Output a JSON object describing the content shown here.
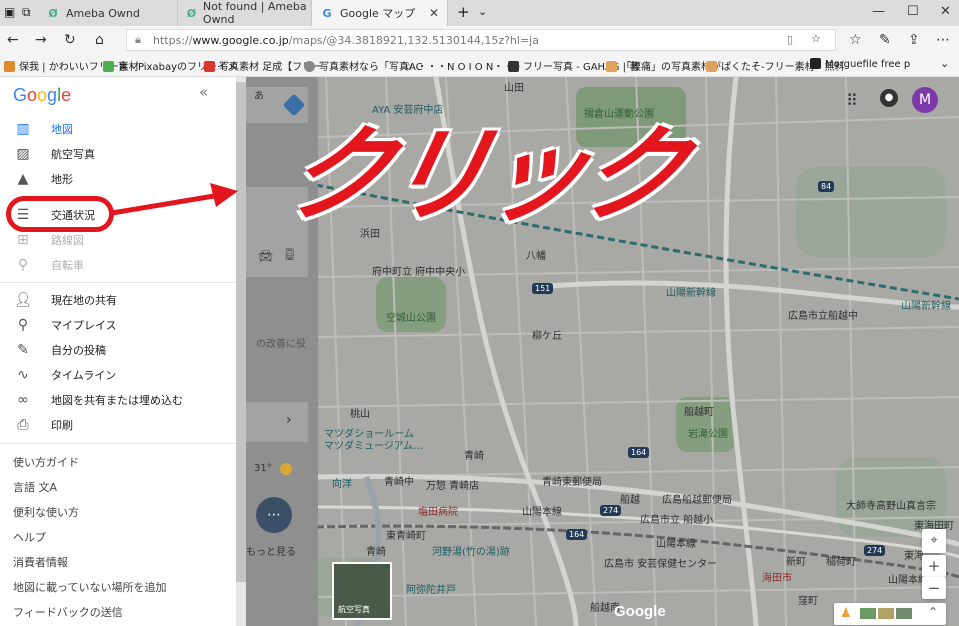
{
  "browser": {
    "tabs": [
      {
        "title": "Ameba Ownd"
      },
      {
        "title": "Not found | Ameba Ownd"
      },
      {
        "title": "Google マップ"
      }
    ],
    "new_tab": "+",
    "url_prefix": "https://",
    "url_host": "www.google.co.jp",
    "url_path": "/maps/@34.3818921,132.5130144,15z?hl=ja"
  },
  "favorites": [
    {
      "label": "保我 | かわいいフリー素材",
      "color": "#e08a2c"
    },
    {
      "label": "盲 - Pixabayのフリーイメ",
      "color": "#4caf50"
    },
    {
      "label": "写真素材 足成【フリー",
      "color": "#d8372f"
    },
    {
      "label": "写真素材なら「写真AC",
      "color": "#888888"
    },
    {
      "label": "・・・N O I O N・・・",
      "color": "#ffffff"
    },
    {
      "label": "フリー写真 - GAHAG | 著",
      "color": "#333333"
    },
    {
      "label": "「腰痛」の写真素材が",
      "color": "#e0a060"
    },
    {
      "label": "ぱくたそ-フリー素材・無料",
      "color": "#e0a060"
    },
    {
      "label": "Morguefile free photo",
      "color": "#222222"
    }
  ],
  "sidebar": {
    "logo": "Google",
    "collapse": "«",
    "layers": [
      {
        "label": "地図",
        "state": "active"
      },
      {
        "label": "航空写真",
        "state": "normal"
      },
      {
        "label": "地形",
        "state": "normal"
      },
      {
        "label": "交通状況",
        "state": "normal"
      },
      {
        "label": "路線図",
        "state": "disabled"
      },
      {
        "label": "自転車",
        "state": "disabled"
      }
    ],
    "actions": [
      {
        "label": "現在地の共有"
      },
      {
        "label": "マイプレイス"
      },
      {
        "label": "自分の投稿"
      },
      {
        "label": "タイムライン"
      },
      {
        "label": "地図を共有または埋め込む"
      },
      {
        "label": "印刷"
      }
    ],
    "links": [
      {
        "label": "使い方ガイド"
      },
      {
        "label": "言語 文A"
      },
      {
        "label": "便利な使い方"
      },
      {
        "label": "ヘルプ"
      },
      {
        "label": "消費者情報"
      },
      {
        "label": "地図に載っていない場所を追加"
      },
      {
        "label": "フィードバックの送信"
      }
    ]
  },
  "annotation": {
    "text": "クリック",
    "color": "#e3151d"
  },
  "panel": {
    "ime": "あ",
    "partial_text": "の改善に役",
    "weather": "31°",
    "more": "もっと見る",
    "aerial_thumb": "航空写真"
  },
  "map": {
    "labels": [
      {
        "text": "AYA 安芸府中店",
        "tone": "teal"
      },
      {
        "text": "揚倉山運動公園",
        "tone": "green"
      },
      {
        "text": "山田",
        "tone": "plain"
      },
      {
        "text": "浜田",
        "tone": "plain"
      },
      {
        "text": "府中町立 府中中央小",
        "tone": "plain"
      },
      {
        "text": "八幡",
        "tone": "plain"
      },
      {
        "text": "山陽新幹線",
        "tone": "teal"
      },
      {
        "text": "山陽新幹線",
        "tone": "teal"
      },
      {
        "text": "空城山公園",
        "tone": "green"
      },
      {
        "text": "柳ケ丘",
        "tone": "plain"
      },
      {
        "text": "広島市立船越中",
        "tone": "plain"
      },
      {
        "text": "桃山",
        "tone": "plain"
      },
      {
        "text": "マツダショールーム",
        "tone": "teal"
      },
      {
        "text": "マツダミュージアム…",
        "tone": "teal"
      },
      {
        "text": "船越町",
        "tone": "plain"
      },
      {
        "text": "岩滝公園",
        "tone": "green"
      },
      {
        "text": "青崎",
        "tone": "plain"
      },
      {
        "text": "青崎中",
        "tone": "plain"
      },
      {
        "text": "向洋",
        "tone": "teal"
      },
      {
        "text": "万惣 青崎店",
        "tone": "plain"
      },
      {
        "text": "青崎東郵便局",
        "tone": "plain"
      },
      {
        "text": "船越",
        "tone": "plain"
      },
      {
        "text": "広島船越郵便局",
        "tone": "plain"
      },
      {
        "text": "大師寺高野山真言宗",
        "tone": "plain"
      },
      {
        "text": "塩田病院",
        "tone": "red"
      },
      {
        "text": "山陽本線",
        "tone": "plain"
      },
      {
        "text": "広島市立 船越小",
        "tone": "plain"
      },
      {
        "text": "東海田町",
        "tone": "plain"
      },
      {
        "text": "東青崎町",
        "tone": "plain"
      },
      {
        "text": "山陽本線",
        "tone": "plain"
      },
      {
        "text": "青崎",
        "tone": "plain"
      },
      {
        "text": "河野湯(竹の湯)跡",
        "tone": "teal"
      },
      {
        "text": "広島市 安芸保健センター",
        "tone": "plain"
      },
      {
        "text": "新町",
        "tone": "plain"
      },
      {
        "text": "稲荷町",
        "tone": "plain"
      },
      {
        "text": "東海",
        "tone": "plain"
      },
      {
        "text": "阿弥陀井戸",
        "tone": "teal"
      },
      {
        "text": "海田市",
        "tone": "red"
      },
      {
        "text": "山陽本線",
        "tone": "plain"
      },
      {
        "text": "船越南",
        "tone": "plain"
      },
      {
        "text": "窪町",
        "tone": "plain"
      }
    ],
    "shields": [
      "84",
      "151",
      "164",
      "274",
      "164",
      "274",
      "84",
      "164"
    ],
    "watermark": "Google",
    "account_initial": "M",
    "zoom_in": "+",
    "zoom_out": "−"
  }
}
